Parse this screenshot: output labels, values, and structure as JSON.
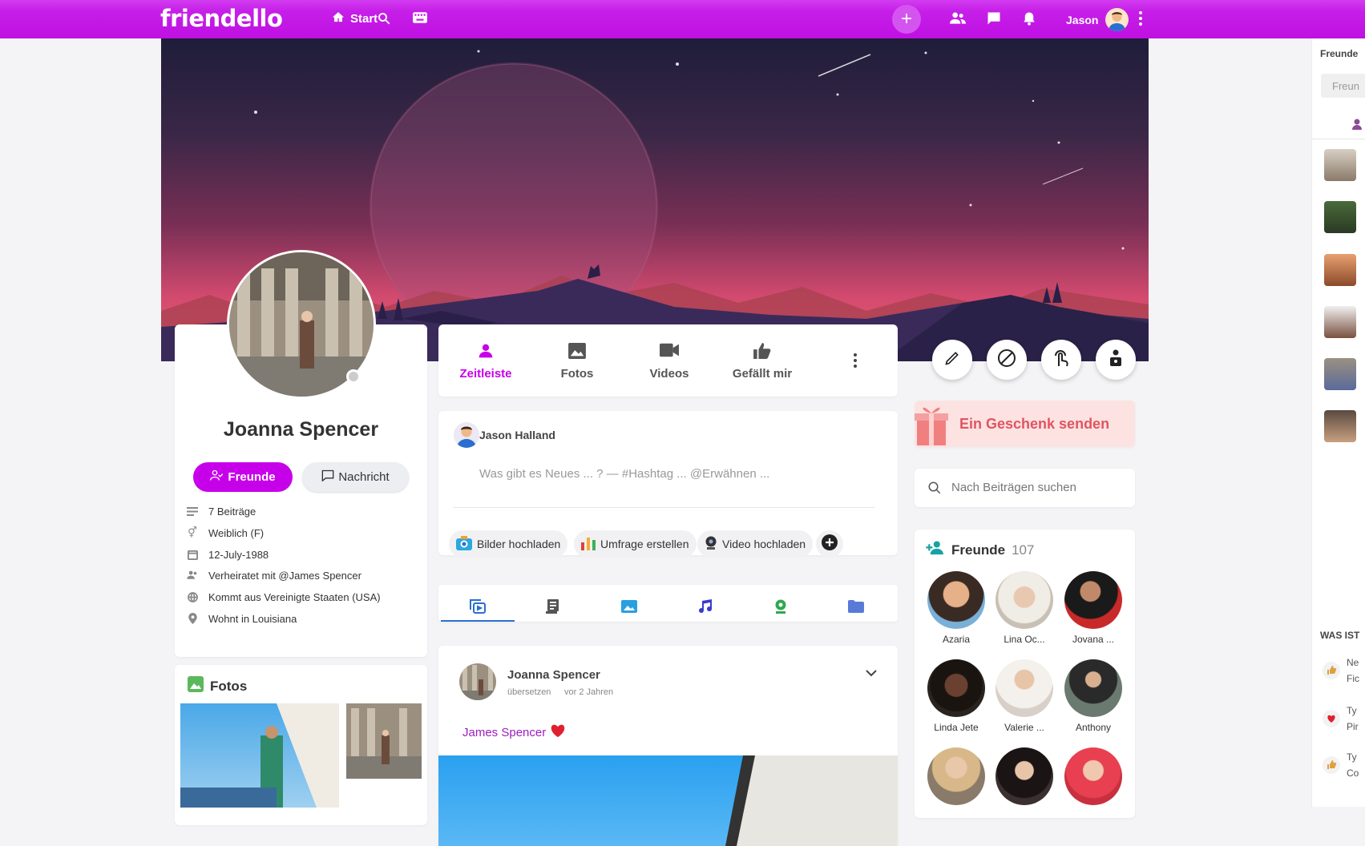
{
  "topbar": {
    "logo": "friendello",
    "start_label": "Start",
    "username": "Jason"
  },
  "profile": {
    "name": "Joanna Spencer",
    "friends_button": "Freunde",
    "message_button": "Nachricht",
    "info": [
      {
        "icon": "lines-icon",
        "text": "7 Beiträge"
      },
      {
        "icon": "gender-icon",
        "text": "Weiblich (F)"
      },
      {
        "icon": "calendar-icon",
        "text": "12-July-1988"
      },
      {
        "icon": "couple-icon",
        "text": "Verheiratet mit @James Spencer"
      },
      {
        "icon": "globe-icon",
        "text": "Kommt aus Vereinigte Staaten (USA)"
      },
      {
        "icon": "pin-icon",
        "text": "Wohnt in Louisiana"
      }
    ],
    "photos_title": "Fotos"
  },
  "tabs": [
    {
      "label": "Zeitleiste",
      "icon": "person-icon",
      "active": true
    },
    {
      "label": "Fotos",
      "icon": "image-icon",
      "active": false
    },
    {
      "label": "Videos",
      "icon": "video-icon",
      "active": false
    },
    {
      "label": "Gefällt mir",
      "icon": "thumbs-up-icon",
      "active": false
    }
  ],
  "composer": {
    "author": "Jason Halland",
    "placeholder": "Was gibt es Neues ... ? — #Hashtag ... @Erwähnen ...",
    "actions": [
      "Bilder hochladen",
      "Umfrage erstellen",
      "Video hochladen"
    ]
  },
  "post": {
    "author": "Joanna Spencer",
    "translate": "übersetzen",
    "time": "vor 2 Jahren",
    "mention": "James Spencer"
  },
  "gift": {
    "label": "Ein Geschenk senden"
  },
  "search": {
    "placeholder": "Nach Beiträgen suchen"
  },
  "friends": {
    "title": "Freunde",
    "count": "107",
    "list": [
      "Azaria",
      "Lina Oc...",
      "Jovana ...",
      "Linda Jete",
      "Valerie ...",
      "Anthony",
      "",
      "",
      ""
    ]
  },
  "right_sidebar": {
    "title": "Freunde",
    "search_placeholder": "Freun",
    "section": "WAS IST",
    "notes": [
      {
        "l1": "Ne",
        "l2": "Fic"
      },
      {
        "l1": "Ty",
        "l2": "Pir"
      },
      {
        "l1": "Ty",
        "l2": "Co"
      }
    ]
  },
  "colors": {
    "accent": "#c700ea",
    "gift": "#e05560"
  }
}
